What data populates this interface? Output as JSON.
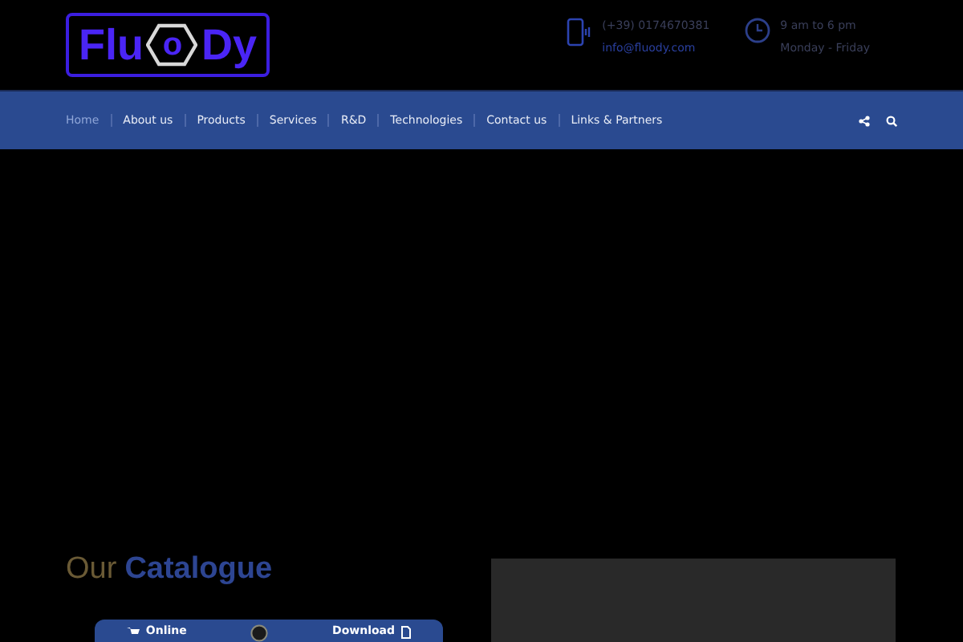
{
  "logo": {
    "left": "Flu",
    "center": "o",
    "right": "Dy"
  },
  "contact": [
    {
      "kind": "phone",
      "line1": "(+39) 0174670381",
      "line2": "info@fluody.com"
    },
    {
      "kind": "clock",
      "line1": "9 am to 6 pm",
      "line2": "Monday - Friday"
    }
  ],
  "nav": {
    "items": [
      {
        "label": "Home",
        "selected": true
      },
      {
        "label": "About us",
        "selected": false
      },
      {
        "label": "Products",
        "selected": false
      },
      {
        "label": "Services",
        "selected": false
      },
      {
        "label": "R&D",
        "selected": false
      },
      {
        "label": "Technologies",
        "selected": false
      },
      {
        "label": "Contact us",
        "selected": false
      },
      {
        "label": "Links & Partners",
        "selected": false
      }
    ]
  },
  "catalogue": {
    "title_light": "Our",
    "title_bold": "Catalogue",
    "buttons": [
      {
        "kind": "online",
        "label": "Online"
      },
      {
        "kind": "download",
        "label": "Download"
      }
    ]
  }
}
